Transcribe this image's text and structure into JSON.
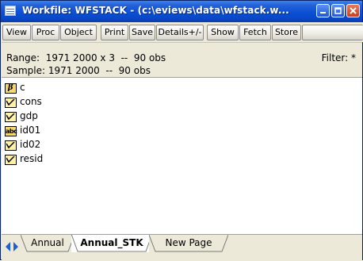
{
  "window": {
    "title": "Workfile: WFSTACK - (c:\\eviews\\data\\wfstack.w..."
  },
  "toolbar": {
    "buttons": [
      "View",
      "Proc",
      "Object",
      "Print",
      "Save",
      "Details+/-",
      "Show",
      "Fetch",
      "Store"
    ]
  },
  "info": {
    "range": "Range:  1971 2000 x 3  --  90 obs",
    "sample": "Sample: 1971 2000  --  90 obs",
    "filter": "Filter: *"
  },
  "objects": [
    {
      "name": "c",
      "icon": "coefficient-icon"
    },
    {
      "name": "cons",
      "icon": "series-icon"
    },
    {
      "name": "gdp",
      "icon": "series-icon"
    },
    {
      "name": "id01",
      "icon": "alpha-series-icon",
      "icon_text": "abc"
    },
    {
      "name": "id02",
      "icon": "series-icon"
    },
    {
      "name": "resid",
      "icon": "series-icon"
    }
  ],
  "coef_icon_text": "β",
  "tabs": [
    {
      "label": "Annual",
      "active": false
    },
    {
      "label": "Annual_STK",
      "active": true
    },
    {
      "label": "New Page",
      "active": false
    }
  ]
}
